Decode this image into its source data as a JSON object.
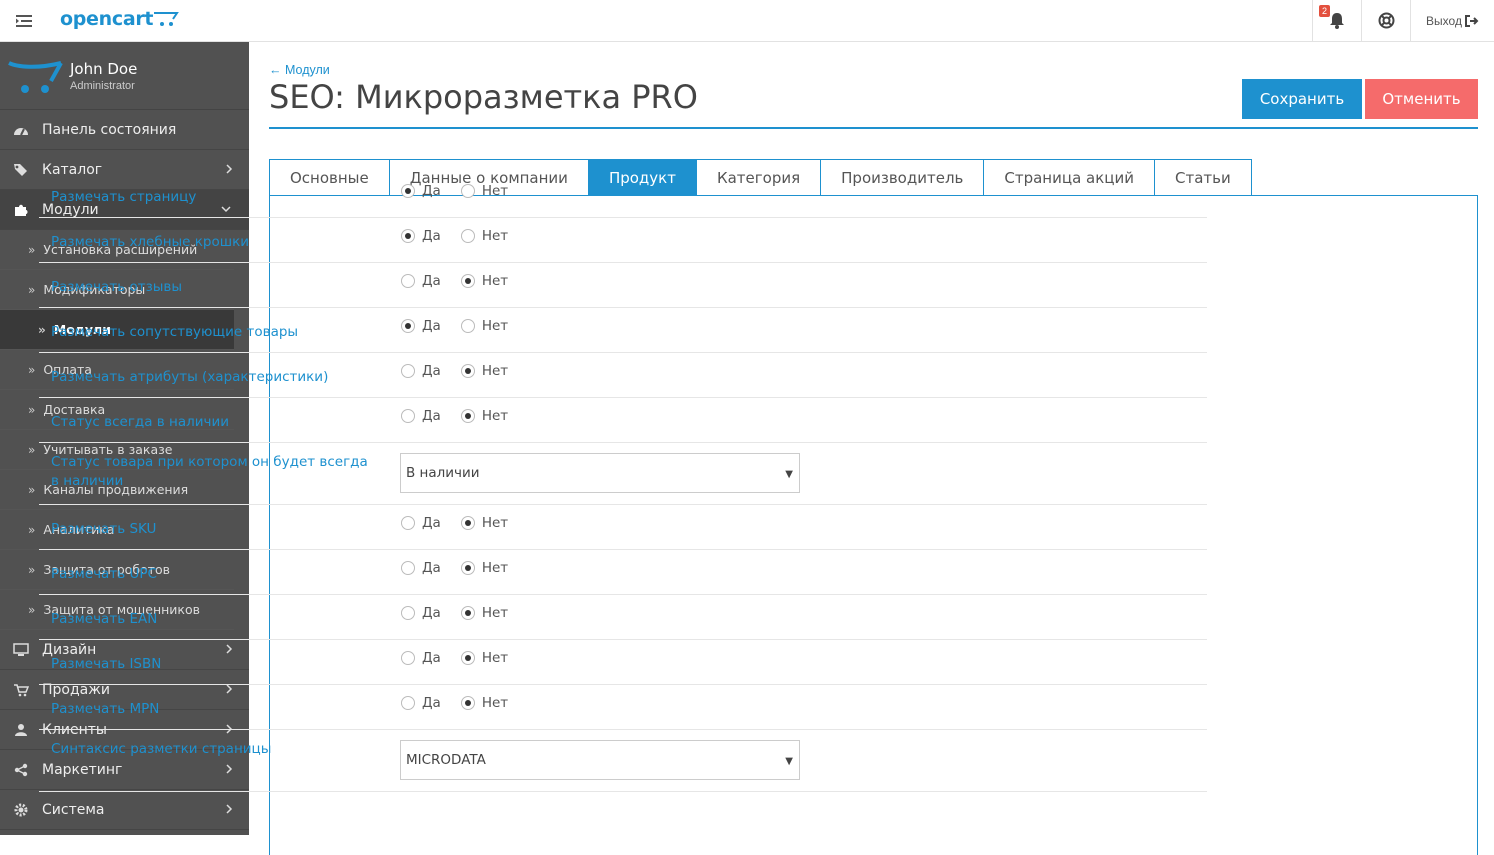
{
  "header": {
    "logo": "opencart",
    "notifications_count": "2",
    "logout_label": "Выход"
  },
  "profile": {
    "name": "John Doe",
    "role": "Administrator"
  },
  "sidebar": {
    "items": [
      {
        "label": "Панель состояния",
        "icon": "dashboard-icon"
      },
      {
        "label": "Каталог",
        "icon": "tags-icon"
      },
      {
        "label": "Модули",
        "icon": "puzzle-icon"
      },
      {
        "label": "Дизайн",
        "icon": "desktop-icon"
      },
      {
        "label": "Продажи",
        "icon": "cart-icon"
      },
      {
        "label": "Клиенты",
        "icon": "user-icon"
      },
      {
        "label": "Маркетинг",
        "icon": "share-icon"
      },
      {
        "label": "Система",
        "icon": "cog-icon"
      }
    ],
    "subitems": [
      "Установка расширений",
      "Модификаторы",
      "Модули",
      "Оплата",
      "Доставка",
      "Учитывать в заказе",
      "Каналы продвижения",
      "Аналитика",
      "Защита от роботов",
      "Защита от мошенников"
    ]
  },
  "page": {
    "breadcrumb": "← Модули",
    "title": "SEO: Микроразметка PRO",
    "save_label": "Сохранить",
    "cancel_label": "Отменить"
  },
  "tabs": [
    "Основные",
    "Данные о компании",
    "Продукт",
    "Категория",
    "Производитель",
    "Страница акций",
    "Статьи"
  ],
  "radio_labels": {
    "yes": "Да",
    "no": "Нет"
  },
  "form": {
    "rows": [
      {
        "label": "Размечать страницу",
        "value": "yes"
      },
      {
        "label": "Размечать хлебные крошки",
        "value": "yes"
      },
      {
        "label": "Размечать отзывы",
        "value": "no"
      },
      {
        "label": "Размечать сопутствующие товары",
        "value": "yes"
      },
      {
        "label": "Размечать атрибуты (характеристики)",
        "value": "no"
      },
      {
        "label": "Статус всегда в наличии",
        "value": "no"
      },
      {
        "label": "Статус товара при котором он будет всегда в наличии",
        "select": "В наличии"
      },
      {
        "label": "Размечать SKU",
        "value": "no"
      },
      {
        "label": "Размечать UPC",
        "value": "no"
      },
      {
        "label": "Размечать EAN",
        "value": "no"
      },
      {
        "label": "Размечать ISBN",
        "value": "no"
      },
      {
        "label": "Размечать MPN",
        "value": "no"
      },
      {
        "label": "Синтаксис разметки страницы",
        "select": "MICRODATA"
      }
    ]
  },
  "colors": {
    "accent": "#1e91cf",
    "cancel": "#f56b6b",
    "sidebar": "#515151"
  }
}
